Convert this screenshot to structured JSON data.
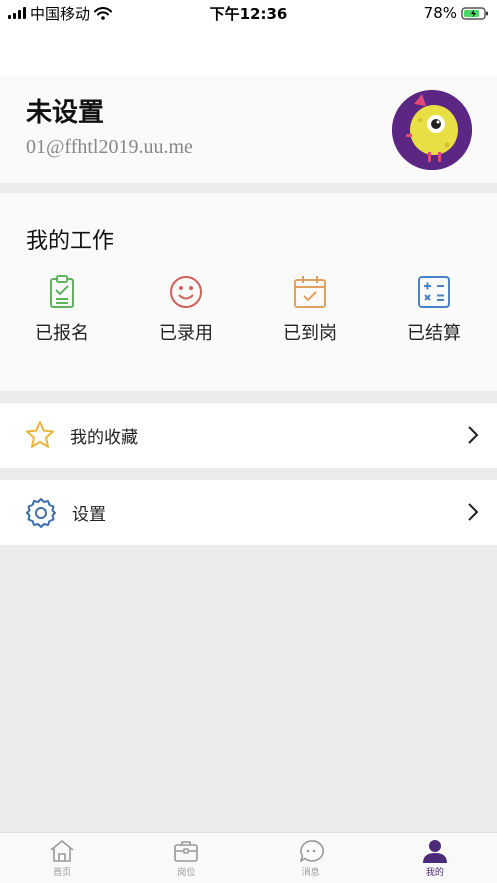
{
  "status_bar": {
    "carrier": "中国移动",
    "time": "下午12:36",
    "battery": "78%"
  },
  "profile": {
    "name": "未设置",
    "email": "01@ffhtl2019.uu.me"
  },
  "work": {
    "title": "我的工作",
    "items": [
      {
        "label": "已报名",
        "icon": "clipboard-check-icon",
        "color": "#5fb35f"
      },
      {
        "label": "已录用",
        "icon": "smile-icon",
        "color": "#d2605a"
      },
      {
        "label": "已到岗",
        "icon": "calendar-check-icon",
        "color": "#e0a060"
      },
      {
        "label": "已结算",
        "icon": "calculator-icon",
        "color": "#4a84c4"
      }
    ]
  },
  "menu": {
    "favorites": {
      "label": "我的收藏",
      "icon": "star-icon",
      "color": "#e9b53a"
    },
    "settings": {
      "label": "设置",
      "icon": "gear-icon",
      "color": "#3f6fa8"
    }
  },
  "tabbar": {
    "tabs": [
      {
        "label": "首页",
        "icon": "home-icon",
        "active": false
      },
      {
        "label": "岗位",
        "icon": "briefcase-icon",
        "active": false
      },
      {
        "label": "消息",
        "icon": "chat-icon",
        "active": false
      },
      {
        "label": "我的",
        "icon": "user-icon",
        "active": true
      }
    ],
    "active_color": "#4b2a78"
  }
}
